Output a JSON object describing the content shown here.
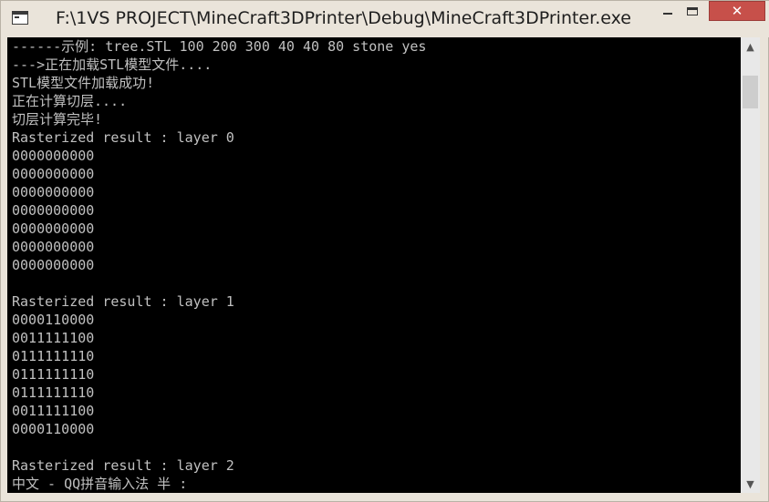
{
  "window": {
    "title": "F:\\1VS PROJECT\\MineCraft3DPrinter\\Debug\\MineCraft3DPrinter.exe",
    "icon": "console-app-icon",
    "controls": {
      "minimize_icon": "minimize-icon",
      "maximize_icon": "maximize-icon",
      "close_glyph": "✕"
    }
  },
  "console": {
    "lines": [
      "------示例: tree.STL 100 200 300 40 40 80 stone yes",
      "--->正在加载STL模型文件....",
      "STL模型文件加载成功!",
      "正在计算切层....",
      "切层计算完毕!",
      "Rasterized result : layer 0",
      "0000000000",
      "0000000000",
      "0000000000",
      "0000000000",
      "0000000000",
      "0000000000",
      "0000000000",
      "",
      "Rasterized result : layer 1",
      "0000110000",
      "0011111100",
      "0111111110",
      "0111111110",
      "0111111110",
      "0011111100",
      "0000110000",
      "",
      "Rasterized result : layer 2"
    ],
    "ime_status": "中文 - QQ拼音输入法 半 :"
  },
  "scrollbar": {
    "up_glyph": "▲",
    "down_glyph": "▼",
    "position_fraction": 0.05
  }
}
